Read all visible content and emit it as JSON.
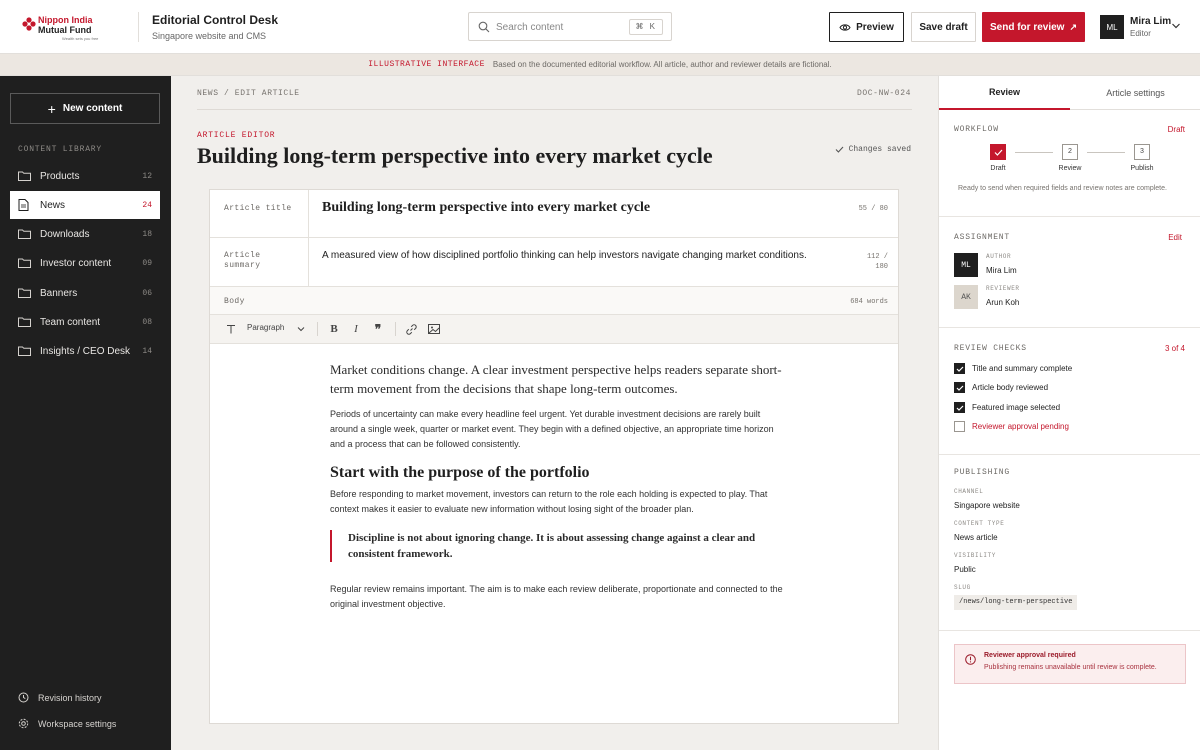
{
  "brand": {
    "line1": "Nippon India",
    "line2": "Mutual Fund",
    "tagline": "Wealth sets you free",
    "accent": "#c4172c"
  },
  "header": {
    "title": "Editorial Control Desk",
    "subtitle": "Singapore website and CMS",
    "search_placeholder": "Search content",
    "search_shortcut": "⌘ K",
    "preview_label": "Preview",
    "save_label": "Save draft",
    "send_label": "Send for review",
    "user_initials": "ML",
    "user_name": "Mira Lim",
    "user_role": "Editor"
  },
  "banner": {
    "tag": "ILLUSTRATIVE INTERFACE",
    "text": "Based on the documented editorial workflow. All article, author and reviewer details are fictional."
  },
  "sidebar": {
    "new_label": "New content",
    "section_label": "CONTENT LIBRARY",
    "items": [
      {
        "label": "Products",
        "count": "12",
        "icon": "folder-icon"
      },
      {
        "label": "News",
        "count": "24",
        "icon": "document-icon"
      },
      {
        "label": "Downloads",
        "count": "18",
        "icon": "folder-icon"
      },
      {
        "label": "Investor content",
        "count": "09",
        "icon": "folder-icon"
      },
      {
        "label": "Banners",
        "count": "06",
        "icon": "folder-icon"
      },
      {
        "label": "Team content",
        "count": "08",
        "icon": "folder-icon"
      },
      {
        "label": "Insights / CEO Desk",
        "count": "14",
        "icon": "folder-icon"
      }
    ],
    "active_index": 1,
    "footer": {
      "history_label": "Revision history",
      "settings_label": "Workspace settings"
    }
  },
  "editor": {
    "breadcrumb": "NEWS / EDIT ARTICLE",
    "doc_id": "DOC-NW-024",
    "kicker": "ARTICLE EDITOR",
    "heading": "Building long-term perspective into every market cycle",
    "saved_status": "Changes saved",
    "fields": {
      "title_label": "Article title",
      "title_value": "Building long-term perspective into every market cycle",
      "title_count": "55 / 80",
      "summary_label_1": "Article",
      "summary_label_2": "summary",
      "summary_value": "A measured view of how disciplined portfolio thinking can help investors navigate changing market conditions.",
      "summary_count_1": "112 /",
      "summary_count_2": "180",
      "body_label": "Body",
      "word_count": "684 words"
    },
    "toolbar": {
      "paragraph_label": "Paragraph"
    },
    "body": {
      "lead": "Market conditions change. A clear investment perspective helps readers separate short-term movement from the decisions that shape long-term outcomes.",
      "p1": "Periods of uncertainty can make every headline feel urgent. Yet durable investment decisions are rarely built around a single week, quarter or market event. They begin with a defined objective, an appropriate time horizon and a process that can be followed consistently.",
      "h2": "Start with the purpose of the portfolio",
      "p2": "Before responding to market movement, investors can return to the role each holding is expected to play. That context makes it easier to evaluate new information without losing sight of the broader plan.",
      "quote": "Discipline is not about ignoring change. It is about assessing change against a clear and consistent framework.",
      "p3": "Regular review remains important. The aim is to make each review deliberate, proportionate and connected to the original investment objective."
    }
  },
  "panel": {
    "tabs": [
      "Review",
      "Article settings"
    ],
    "workflow": {
      "title": "WORKFLOW",
      "status": "Draft",
      "steps": [
        {
          "num": "",
          "label": "Draft"
        },
        {
          "num": "2",
          "label": "Review"
        },
        {
          "num": "3",
          "label": "Publish"
        }
      ],
      "note": "Ready to send when required fields and review notes are complete."
    },
    "assignment": {
      "title": "ASSIGNMENT",
      "edit_label": "Edit",
      "author_role": "AUTHOR",
      "author_initials": "ML",
      "author_name": "Mira Lim",
      "reviewer_role": "REVIEWER",
      "reviewer_initials": "AK",
      "reviewer_name": "Arun Koh"
    },
    "checks": {
      "title": "REVIEW CHECKS",
      "progress": "3 of 4",
      "items": [
        {
          "label": "Title and summary complete",
          "done": true
        },
        {
          "label": "Article body reviewed",
          "done": true
        },
        {
          "label": "Featured image selected",
          "done": true
        },
        {
          "label": "Reviewer approval pending",
          "done": false
        }
      ]
    },
    "publishing": {
      "title": "PUBLISHING",
      "channel_label": "CHANNEL",
      "channel": "Singapore website",
      "type_label": "CONTENT TYPE",
      "type": "News article",
      "visibility_label": "VISIBILITY",
      "visibility": "Public",
      "slug_label": "SLUG",
      "slug": "/news/long-term-perspective"
    },
    "alert": {
      "title": "Reviewer approval required",
      "text": "Publishing remains unavailable until review is complete."
    }
  }
}
